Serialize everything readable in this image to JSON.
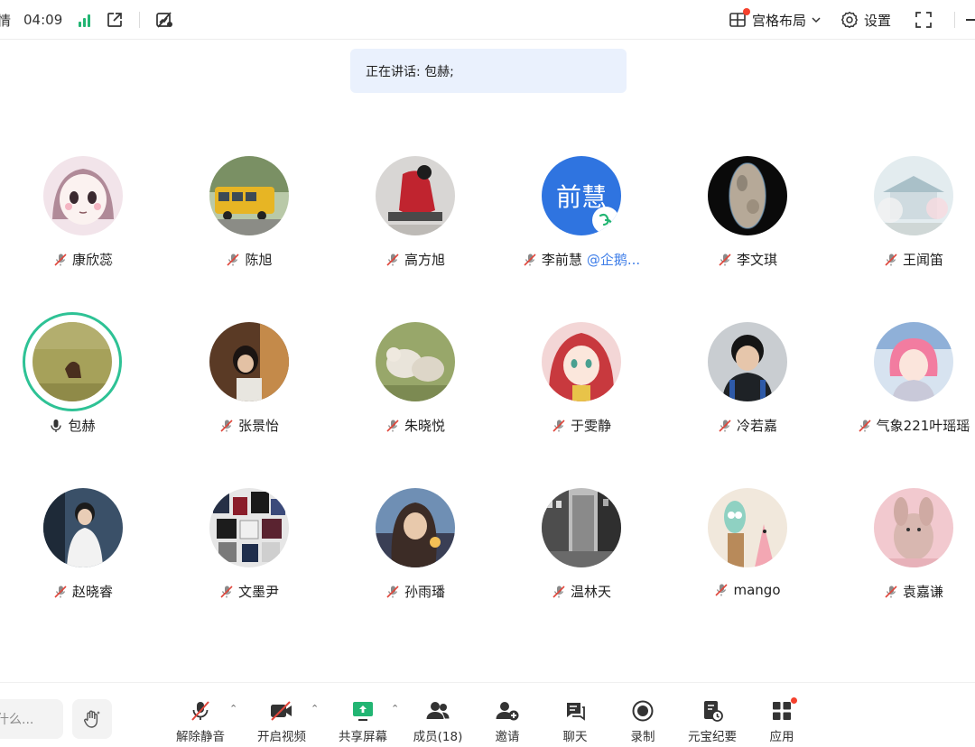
{
  "topbar": {
    "partial_title": "情",
    "timer": "04:09",
    "layout_label": "宫格布局",
    "settings_label": "设置"
  },
  "speaking_banner": "正在讲话: 包赫;",
  "participants": [
    {
      "name": "康欣蕊",
      "muted": true
    },
    {
      "name": "陈旭",
      "muted": true
    },
    {
      "name": "高方旭",
      "muted": true
    },
    {
      "name": "李前慧",
      "org": "@企鹅...",
      "avatar_text": "前慧",
      "muted": true
    },
    {
      "name": "李文琪",
      "muted": true
    },
    {
      "name": "王闻笛",
      "muted": true
    },
    {
      "name": "包赫",
      "muted": false,
      "speaking": true
    },
    {
      "name": "张景怡",
      "muted": true
    },
    {
      "name": "朱晓悦",
      "muted": true
    },
    {
      "name": "于雯静",
      "muted": true
    },
    {
      "name": "冷若嘉",
      "muted": true
    },
    {
      "name": "气象221叶瑶瑶",
      "muted": true
    },
    {
      "name": "赵晓睿",
      "muted": true
    },
    {
      "name": "文墨尹",
      "muted": true
    },
    {
      "name": "孙雨璠",
      "muted": true
    },
    {
      "name": "温林天",
      "muted": true
    },
    {
      "name": "mango",
      "muted": true
    },
    {
      "name": "袁嘉谦",
      "muted": true
    }
  ],
  "bottombar": {
    "chat_placeholder": "什么...",
    "tools": [
      {
        "label": "解除静音",
        "icon": "mic-muted-icon"
      },
      {
        "label": "开启视频",
        "icon": "video-off-icon"
      },
      {
        "label": "共享屏幕",
        "icon": "share-screen-icon"
      },
      {
        "label": "成员(18)",
        "icon": "members-icon"
      },
      {
        "label": "邀请",
        "icon": "invite-icon"
      },
      {
        "label": "聊天",
        "icon": "chat-icon"
      },
      {
        "label": "录制",
        "icon": "record-icon"
      },
      {
        "label": "元宝纪要",
        "icon": "minutes-icon"
      },
      {
        "label": "应用",
        "icon": "apps-icon"
      }
    ]
  },
  "colors": {
    "accent_green": "#2ec295",
    "signal_green": "#22b573",
    "link_blue": "#3d7de8",
    "mute_red": "#e0453a",
    "banner_bg": "#eaf1fd",
    "notify_red": "#f5412d"
  }
}
